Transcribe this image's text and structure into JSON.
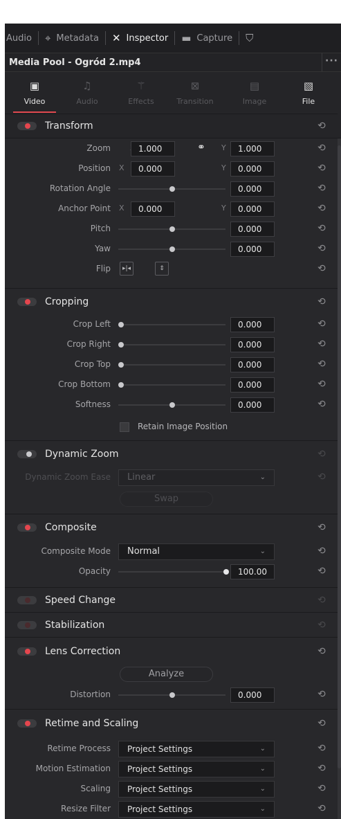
{
  "topbar": {
    "items": [
      {
        "label": "Audio",
        "icon": "audio-icon"
      },
      {
        "label": "Metadata",
        "icon": "tag-icon"
      },
      {
        "label": "Inspector",
        "icon": "tools-icon",
        "active": true
      },
      {
        "label": "Capture",
        "icon": "capture-card-icon"
      }
    ],
    "end_icon": "presentation-icon"
  },
  "title": "Media Pool - Ogród 2.mp4",
  "more_label": "···",
  "tabs": [
    {
      "label": "Video",
      "icon": "film-icon",
      "active": true
    },
    {
      "label": "Audio",
      "icon": "music-note-icon"
    },
    {
      "label": "Effects",
      "icon": "magic-wand-icon"
    },
    {
      "label": "Transition",
      "icon": "transition-icon"
    },
    {
      "label": "Image",
      "icon": "image-icon"
    },
    {
      "label": "File",
      "icon": "file-icon"
    }
  ],
  "reset_glyph": "⟲",
  "transform": {
    "title": "Transform",
    "zoom_label": "Zoom",
    "zoom_x": "1.000",
    "zoom_y": "1.000",
    "position_label": "Position",
    "position_x": "0.000",
    "position_y": "0.000",
    "rotation_label": "Rotation Angle",
    "rotation_value": "0.000",
    "anchor_label": "Anchor Point",
    "anchor_x": "0.000",
    "anchor_y": "0.000",
    "pitch_label": "Pitch",
    "pitch_value": "0.000",
    "yaw_label": "Yaw",
    "yaw_value": "0.000",
    "flip_label": "Flip",
    "x_axis": "X",
    "y_axis": "Y"
  },
  "cropping": {
    "title": "Cropping",
    "crop_left_label": "Crop Left",
    "crop_left_value": "0.000",
    "crop_right_label": "Crop Right",
    "crop_right_value": "0.000",
    "crop_top_label": "Crop Top",
    "crop_top_value": "0.000",
    "crop_bottom_label": "Crop Bottom",
    "crop_bottom_value": "0.000",
    "softness_label": "Softness",
    "softness_value": "0.000",
    "retain_label": "Retain Image Position"
  },
  "dynamic_zoom": {
    "title": "Dynamic Zoom",
    "ease_label": "Dynamic Zoom Ease",
    "ease_value": "Linear",
    "swap_label": "Swap"
  },
  "composite": {
    "title": "Composite",
    "mode_label": "Composite Mode",
    "mode_value": "Normal",
    "opacity_label": "Opacity",
    "opacity_value": "100.00"
  },
  "speed_change": {
    "title": "Speed Change"
  },
  "stabilization": {
    "title": "Stabilization"
  },
  "lens_correction": {
    "title": "Lens Correction",
    "analyze_label": "Analyze",
    "distortion_label": "Distortion",
    "distortion_value": "0.000"
  },
  "retime": {
    "title": "Retime and Scaling",
    "process_label": "Retime Process",
    "process_value": "Project Settings",
    "motion_label": "Motion Estimation",
    "motion_value": "Project Settings",
    "scaling_label": "Scaling",
    "scaling_value": "Project Settings",
    "resize_label": "Resize Filter",
    "resize_value": "Project Settings"
  },
  "colors": {
    "accent": "#e4464e",
    "panel": "#28282b",
    "field": "#1a1a1c"
  }
}
